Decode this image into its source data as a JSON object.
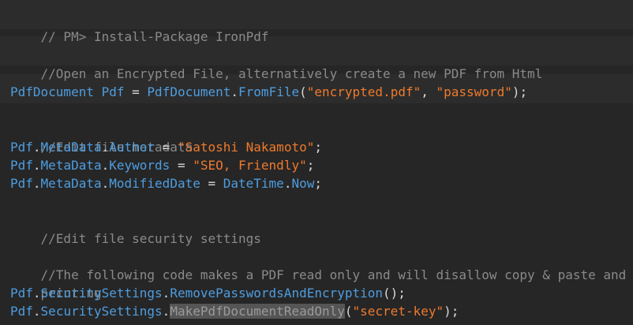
{
  "code": {
    "line1": [
      "// PM> Install-Package IronPdf"
    ],
    "line2": [
      "//Open an Encrypted File, alternatively create a new PDF from Html"
    ],
    "line3": [
      "PdfDocument",
      " ",
      "Pdf",
      " = ",
      "PdfDocument",
      ".",
      "FromFile",
      "(",
      "\"encrypted.pdf\"",
      ", ",
      "\"password\"",
      ");"
    ],
    "line4": [
      "//Edit file metadata"
    ],
    "line5": [
      "Pdf",
      ".",
      "MetaData",
      ".",
      "Author",
      " = ",
      "\"Satoshi Nakamoto\"",
      ";"
    ],
    "line6": [
      "Pdf",
      ".",
      "MetaData",
      ".",
      "Keywords",
      " = ",
      "\"SEO, Friendly\"",
      ";"
    ],
    "line7": [
      "Pdf",
      ".",
      "MetaData",
      ".",
      "ModifiedDate",
      " = ",
      "DateTime",
      ".",
      "Now",
      ";"
    ],
    "line8": [
      "//Edit file security settings"
    ],
    "line9": [
      "//The following code makes a PDF read only and will disallow copy & paste and"
    ],
    "line10": [
      "printing"
    ],
    "line11": [
      "Pdf",
      ".",
      "SecuritySettings",
      ".",
      "RemovePasswordsAndEncryption",
      "();"
    ],
    "line12": [
      "Pdf",
      ".",
      "SecuritySettings",
      ".",
      "MakePdfDocumentReadOnly",
      "(",
      "\"secret-key\"",
      ");"
    ]
  },
  "colors": {
    "background": "#262626",
    "band": "#2c2c2c",
    "comment": "#8a8a8a",
    "type": "#4e9de0",
    "string": "#ee7a2d",
    "selection": "#555555"
  }
}
